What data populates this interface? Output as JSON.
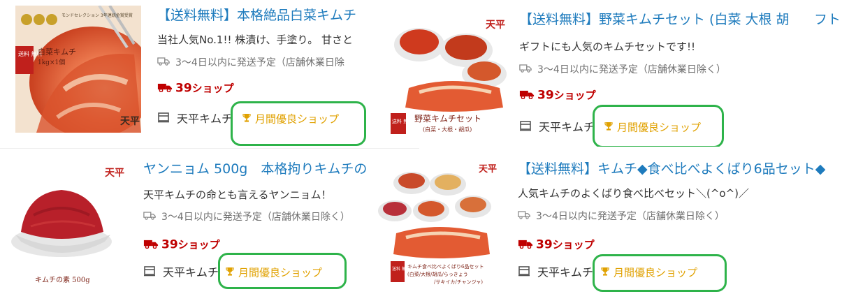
{
  "products": [
    {
      "title": "【送料無料】本格絶品白菜キムチ",
      "description": "当社人気No.1!! 株漬け、手塗り。 甘さと",
      "shipping": "3〜4日以内に発送予定（店舗休業日除",
      "shop_count": "39",
      "shop_label": "ショップ",
      "store_name": "天平キムチ",
      "badge": "月間優良ショップ",
      "image_text": {
        "award": "モンドセレクション 3年連続金賞受賞",
        "ribbon": "送料 無料",
        "product_name": "白菜キムチ",
        "size": "1kg×1個",
        "logo": "天平"
      }
    },
    {
      "title": "【送料無料】野菜キムチセット (白菜 大根 胡",
      "title_overlay": "フト こ",
      "description": "ギフトにも人気のキムチセットです!!",
      "shipping": "3〜4日以内に発送予定（店舗休業日除く）",
      "shop_count": "39",
      "shop_label": "ショップ",
      "store_name": "天平キムチ",
      "badge": "月間優良ショップ",
      "image_text": {
        "logo": "天平",
        "ribbon": "送料 無料",
        "product_name": "野菜キムチセット",
        "sub": "(白菜・大根・胡瓜)"
      }
    },
    {
      "title": "ヤンニョム 500g　本格拘りキムチの",
      "description": "天平キムチの命とも言えるヤンニョム！",
      "shipping": "3〜4日以内に発送予定（店舗休業日除く）",
      "shop_count": "39",
      "shop_label": "ショップ",
      "store_name": "天平キムチ",
      "badge": "月間優良ショップ",
      "image_text": {
        "logo": "天平",
        "caption": "キムチの素 500g"
      }
    },
    {
      "title": "【送料無料】キムチ◆食べ比べよくばり6品セット◆",
      "description": "人気キムチのよくばり食べ比べセット＼(^o^)／",
      "shipping": "3〜4日以内に発送予定（店舗休業日除く）",
      "shop_count": "39",
      "shop_label": "ショップ",
      "store_name": "天平キムチ",
      "badge": "月間優良ショップ",
      "image_text": {
        "logo": "天平",
        "ribbon": "送料 無料",
        "line1": "キムチ食べ比べよくばり6品セット",
        "line2": "(白菜/大根/胡瓜/らっきょう",
        "line3": "/サキイカ/チャンジャ)"
      }
    }
  ],
  "colors": {
    "link": "#1e7bbd",
    "price_red": "#bf0000",
    "badge_gold": "#e0a100",
    "highlight_green": "#2eb34a"
  }
}
